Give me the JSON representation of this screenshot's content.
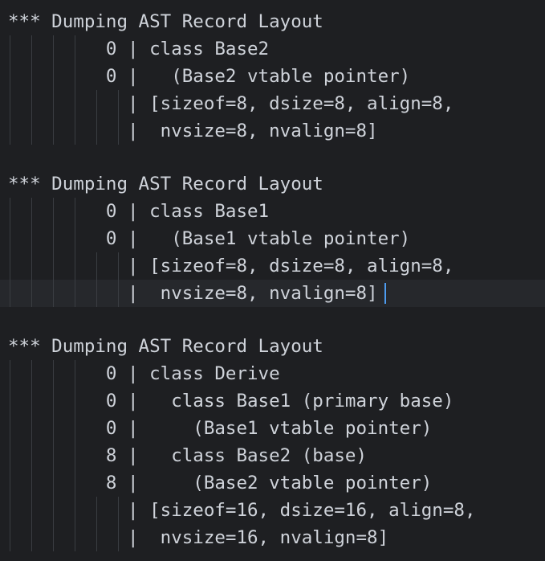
{
  "theme": {
    "background": "#1e1f22",
    "text": "#cfd3da",
    "current_line": "#26282c",
    "indent_guide": "#3a3d42",
    "caret": "#4d9cf0"
  },
  "editor": {
    "lines": [
      "*** Dumping AST Record Layout",
      "         0 | class Base2",
      "         0 |   (Base2 vtable pointer)",
      "           | [sizeof=8, dsize=8, align=8,",
      "           |  nvsize=8, nvalign=8]",
      "",
      "*** Dumping AST Record Layout",
      "         0 | class Base1",
      "         0 |   (Base1 vtable pointer)",
      "           | [sizeof=8, dsize=8, align=8,",
      "           |  nvsize=8, nvalign=8]",
      "",
      "*** Dumping AST Record Layout",
      "         0 | class Derive",
      "         0 |   class Base1 (primary base)",
      "         0 |     (Base1 vtable pointer)",
      "         8 |   class Base2 (base)",
      "         8 |     (Base2 vtable pointer)",
      "           | [sizeof=16, dsize=16, align=8,",
      "           |  nvsize=16, nvalign=8]"
    ]
  }
}
